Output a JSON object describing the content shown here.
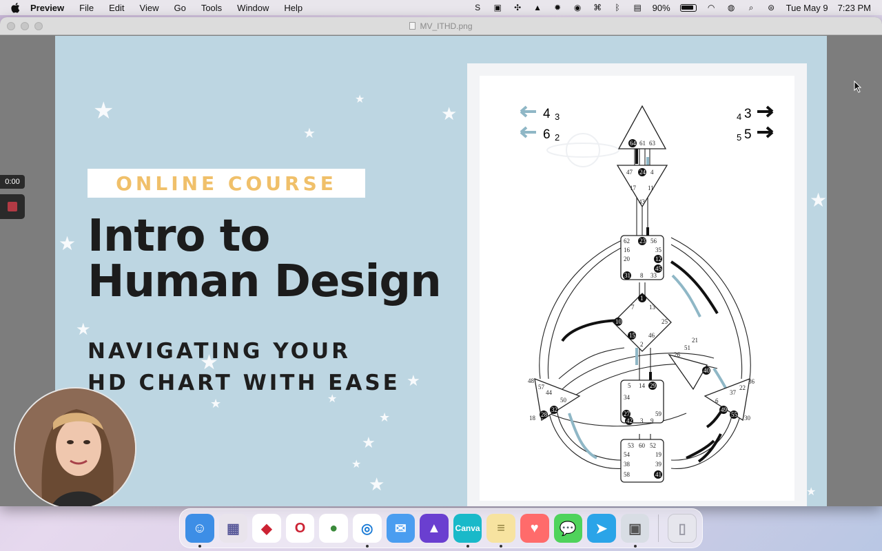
{
  "menubar": {
    "app_name": "Preview",
    "items": [
      "File",
      "Edit",
      "View",
      "Go",
      "Tools",
      "Window",
      "Help"
    ],
    "battery": "90%",
    "date": "Tue May 9",
    "time": "7:23 PM"
  },
  "window": {
    "title": "MV_ITHD.png"
  },
  "slide": {
    "badge": "ONLINE COURSE",
    "headline_line1": "Intro to",
    "headline_line2": "Human Design",
    "sub_line1": "NAVIGATING YOUR",
    "sub_line2": "HD CHART WITH EASE"
  },
  "chart": {
    "left_top": "4",
    "left_top_sub": "3",
    "left_bottom": "6",
    "left_bottom_sub": "2",
    "right_top_sub": "4",
    "right_top": "3",
    "right_bottom_sub": "5",
    "right_bottom": "5",
    "gates": {
      "head": [
        "64",
        "61",
        "63"
      ],
      "ajna": [
        "47",
        "24",
        "4",
        "17",
        "11",
        "43"
      ],
      "throat": [
        "62",
        "23",
        "56",
        "16",
        "35",
        "20",
        "12",
        "45",
        "31",
        "8",
        "33"
      ],
      "g": [
        "1",
        "7",
        "13",
        "10",
        "25",
        "15",
        "46",
        "2"
      ],
      "heart": [
        "21",
        "51",
        "26",
        "40"
      ],
      "sacral": [
        "5",
        "14",
        "29",
        "34",
        "27",
        "59",
        "42",
        "3",
        "9"
      ],
      "spleen": [
        "48",
        "57",
        "44",
        "50",
        "32",
        "28",
        "18"
      ],
      "solar": [
        "36",
        "22",
        "37",
        "6",
        "49",
        "55",
        "30"
      ],
      "root": [
        "53",
        "60",
        "52",
        "54",
        "19",
        "38",
        "39",
        "58",
        "41"
      ]
    }
  },
  "recorder": {
    "time": "0:00"
  },
  "dock": {
    "apps": [
      {
        "name": "finder",
        "color": "#3d8ee6",
        "glyph": "☺",
        "running": true
      },
      {
        "name": "launchpad",
        "color": "#e9e4ec",
        "glyph": "▦",
        "running": false
      },
      {
        "name": "brave",
        "color": "#ffffff",
        "glyph": "◆",
        "running": false
      },
      {
        "name": "opera",
        "color": "#ffffff",
        "glyph": "O",
        "running": false
      },
      {
        "name": "chrome",
        "color": "#ffffff",
        "glyph": "●",
        "running": false
      },
      {
        "name": "safari",
        "color": "#ffffff",
        "glyph": "◎",
        "running": true
      },
      {
        "name": "mail",
        "color": "#4a9df0",
        "glyph": "✉",
        "running": false
      },
      {
        "name": "affinity",
        "color": "#6a3fd0",
        "glyph": "▲",
        "running": false
      },
      {
        "name": "canva",
        "color": "#19b9c9",
        "glyph": "Canva",
        "running": true
      },
      {
        "name": "notes",
        "color": "#f7e3a0",
        "glyph": "≡",
        "running": true
      },
      {
        "name": "health",
        "color": "#ff6b6b",
        "glyph": "♥",
        "running": false
      },
      {
        "name": "messages",
        "color": "#4fd35b",
        "glyph": "💬",
        "running": false
      },
      {
        "name": "telegram",
        "color": "#2aa4e8",
        "glyph": "➤",
        "running": false
      },
      {
        "name": "preview",
        "color": "#d8dde4",
        "glyph": "▣",
        "running": true
      }
    ]
  }
}
